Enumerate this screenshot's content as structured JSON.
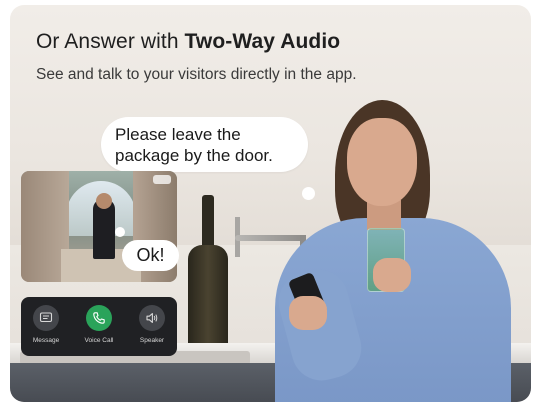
{
  "header": {
    "title_prefix": "Or Answer with ",
    "title_bold": "Two-Way Audio",
    "subtitle": "See and talk to your visitors directly in the app."
  },
  "speech": {
    "visitor_line1": "Please leave the",
    "visitor_line2": "package by the door.",
    "reply": "Ok!"
  },
  "call_controls": [
    {
      "label": "Message",
      "icon": "message-icon"
    },
    {
      "label": "Voice Call",
      "icon": "phone-icon"
    },
    {
      "label": "Speaker",
      "icon": "speaker-icon"
    }
  ],
  "colors": {
    "voice_call_button": "#2aa35a",
    "panel_background": "#202124",
    "control_button": "#44464b"
  }
}
